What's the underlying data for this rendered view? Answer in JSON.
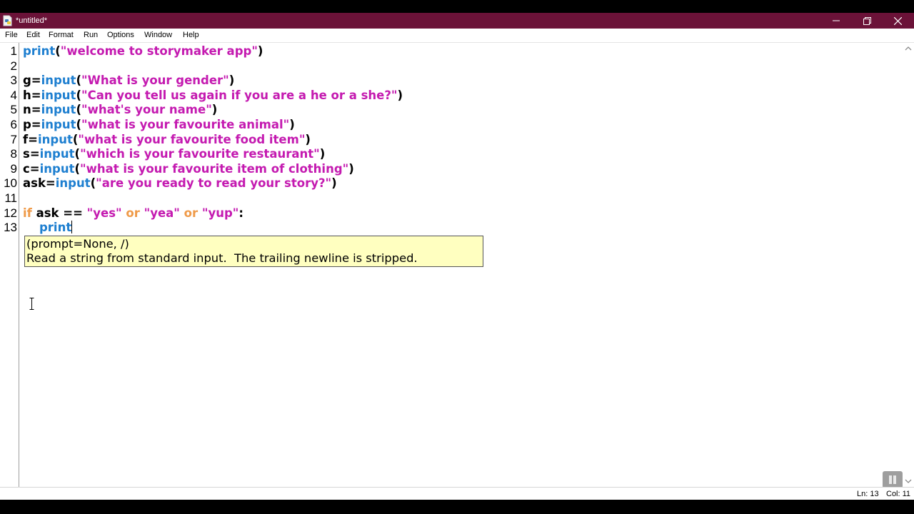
{
  "window": {
    "title": "*untitled*",
    "controls": [
      "minimize-icon",
      "restore-icon",
      "close-icon"
    ]
  },
  "menu": {
    "items": [
      "File",
      "Edit",
      "Format",
      "Run",
      "Options",
      "Window",
      "Help"
    ]
  },
  "editor": {
    "line_numbers": [
      "1",
      "2",
      "3",
      "4",
      "5",
      "6",
      "7",
      "8",
      "9",
      "10",
      "11",
      "12",
      "13"
    ],
    "lines": [
      [
        {
          "t": "print",
          "c": "builtin"
        },
        {
          "t": "(",
          "c": "plain"
        },
        {
          "t": "\"welcome to storymaker app\"",
          "c": "str"
        },
        {
          "t": ")",
          "c": "plain"
        }
      ],
      [],
      [
        {
          "t": "g=",
          "c": "plain"
        },
        {
          "t": "input",
          "c": "builtin"
        },
        {
          "t": "(",
          "c": "plain"
        },
        {
          "t": "\"What is your gender\"",
          "c": "str"
        },
        {
          "t": ")",
          "c": "plain"
        }
      ],
      [
        {
          "t": "h=",
          "c": "plain"
        },
        {
          "t": "input",
          "c": "builtin"
        },
        {
          "t": "(",
          "c": "plain"
        },
        {
          "t": "\"Can you tell us again if you are a he or a she?\"",
          "c": "str"
        },
        {
          "t": ")",
          "c": "plain"
        }
      ],
      [
        {
          "t": "n=",
          "c": "plain"
        },
        {
          "t": "input",
          "c": "builtin"
        },
        {
          "t": "(",
          "c": "plain"
        },
        {
          "t": "\"what's your name\"",
          "c": "str"
        },
        {
          "t": ")",
          "c": "plain"
        }
      ],
      [
        {
          "t": "p=",
          "c": "plain"
        },
        {
          "t": "input",
          "c": "builtin"
        },
        {
          "t": "(",
          "c": "plain"
        },
        {
          "t": "\"what is your favourite animal\"",
          "c": "str"
        },
        {
          "t": ")",
          "c": "plain"
        }
      ],
      [
        {
          "t": "f=",
          "c": "plain"
        },
        {
          "t": "input",
          "c": "builtin"
        },
        {
          "t": "(",
          "c": "plain"
        },
        {
          "t": "\"what is your favourite food item\"",
          "c": "str"
        },
        {
          "t": ")",
          "c": "plain"
        }
      ],
      [
        {
          "t": "s=",
          "c": "plain"
        },
        {
          "t": "input",
          "c": "builtin"
        },
        {
          "t": "(",
          "c": "plain"
        },
        {
          "t": "\"which is your favourite restaurant\"",
          "c": "str"
        },
        {
          "t": ")",
          "c": "plain"
        }
      ],
      [
        {
          "t": "c=",
          "c": "plain"
        },
        {
          "t": "input",
          "c": "builtin"
        },
        {
          "t": "(",
          "c": "plain"
        },
        {
          "t": "\"what is your favourite item of clothing\"",
          "c": "str"
        },
        {
          "t": ")",
          "c": "plain"
        }
      ],
      [
        {
          "t": "ask=",
          "c": "plain"
        },
        {
          "t": "input",
          "c": "builtin"
        },
        {
          "t": "(",
          "c": "plain"
        },
        {
          "t": "\"are you ready to read your story?\"",
          "c": "str"
        },
        {
          "t": ")",
          "c": "plain"
        }
      ],
      [],
      [
        {
          "t": "if",
          "c": "kw"
        },
        {
          "t": " ask == ",
          "c": "plain"
        },
        {
          "t": "\"yes\"",
          "c": "str"
        },
        {
          "t": " ",
          "c": "plain"
        },
        {
          "t": "or",
          "c": "kw"
        },
        {
          "t": " ",
          "c": "plain"
        },
        {
          "t": "\"yea\"",
          "c": "str"
        },
        {
          "t": " ",
          "c": "plain"
        },
        {
          "t": "or",
          "c": "kw"
        },
        {
          "t": " ",
          "c": "plain"
        },
        {
          "t": "\"yup\"",
          "c": "str"
        },
        {
          "t": ":",
          "c": "plain"
        }
      ],
      [
        {
          "t": "    ",
          "c": "plain"
        },
        {
          "t": "print",
          "c": "builtin"
        }
      ]
    ],
    "caret_line": 13
  },
  "calltip": {
    "signature": "(prompt=None, /)",
    "description": "Read a string from standard input.  The trailing newline is stripped."
  },
  "status": {
    "line": "Ln: 13",
    "col": "Col: 11"
  },
  "colors": {
    "titlebar": "#6b1238",
    "builtin": "#1e7fd0",
    "string": "#c41ab0",
    "keyword": "#ef9a48",
    "calltip_bg": "#ffffc0"
  }
}
